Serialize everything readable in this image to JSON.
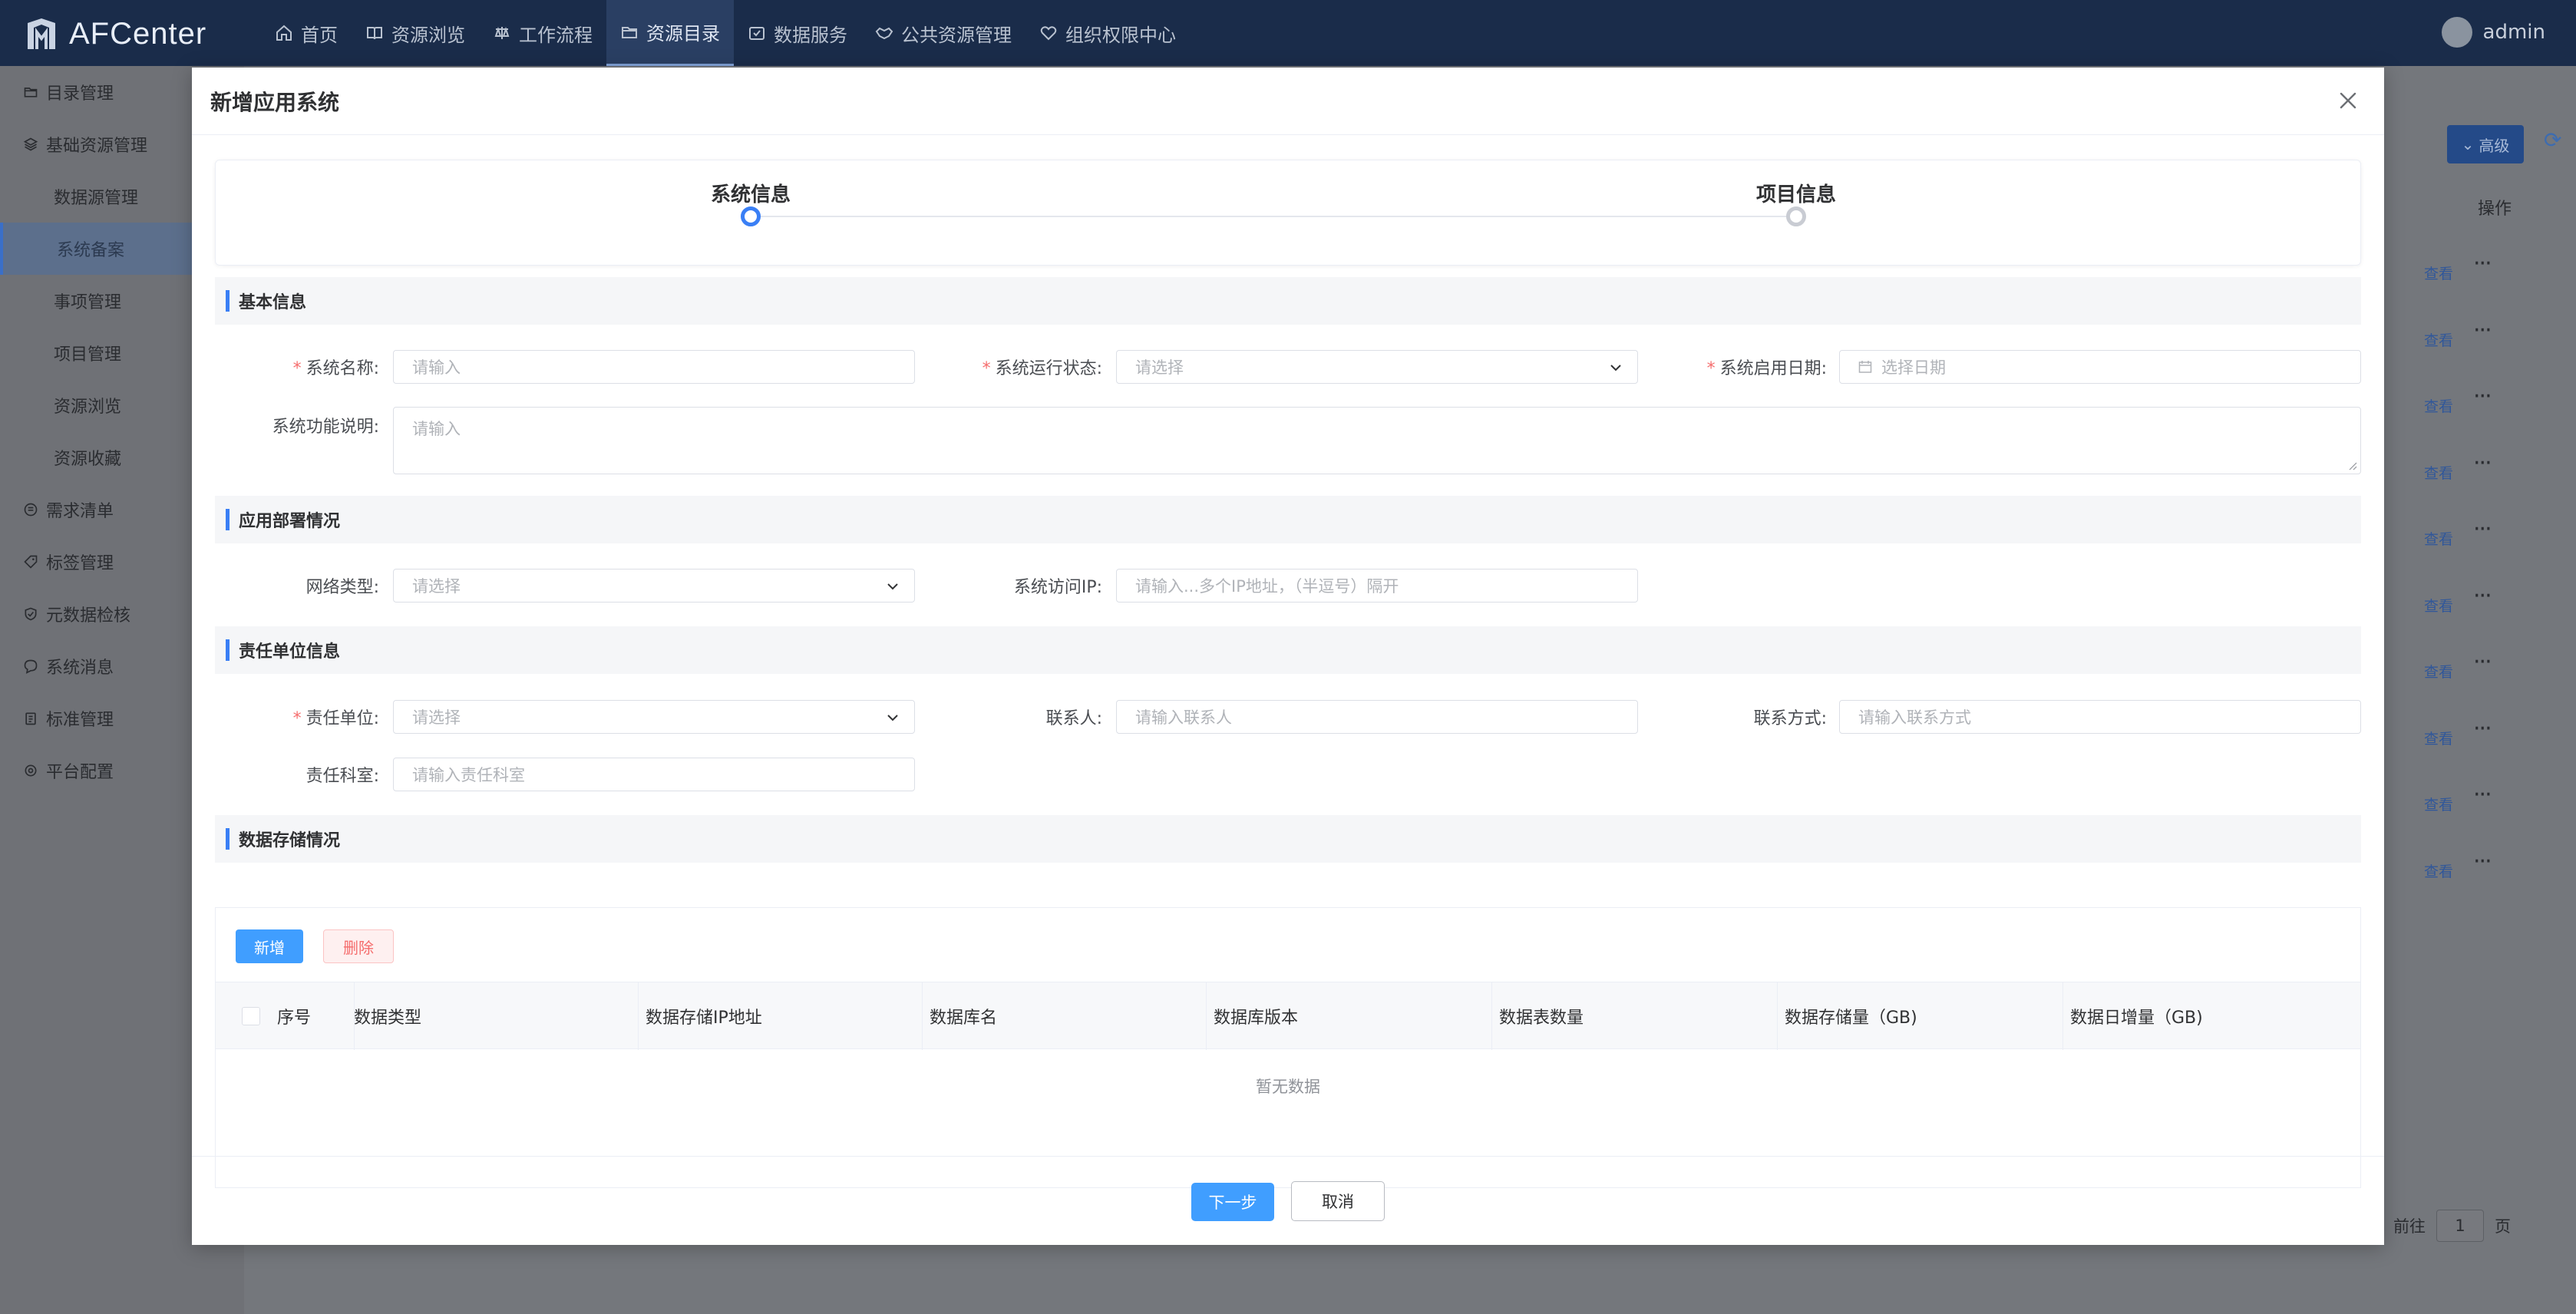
{
  "app": {
    "logo_text": "AFCenter",
    "user": "admin"
  },
  "nav": [
    {
      "label": "首页",
      "icon": "home-icon"
    },
    {
      "label": "资源浏览",
      "icon": "book-icon"
    },
    {
      "label": "工作流程",
      "icon": "workflow-icon"
    },
    {
      "label": "资源目录",
      "icon": "folder-icon",
      "active": true
    },
    {
      "label": "数据服务",
      "icon": "data-service-icon"
    },
    {
      "label": "公共资源管理",
      "icon": "public-resource-icon"
    },
    {
      "label": "组织权限中心",
      "icon": "heart-shield-icon"
    }
  ],
  "sidebar": [
    {
      "label": "目录管理",
      "icon": "folder-icon"
    },
    {
      "label": "基础资源管理",
      "icon": "layers-icon"
    },
    {
      "label": "数据源管理",
      "sub": true
    },
    {
      "label": "系统备案",
      "sub": true,
      "active": true
    },
    {
      "label": "事项管理",
      "sub": true
    },
    {
      "label": "项目管理",
      "sub": true
    },
    {
      "label": "资源浏览",
      "sub": true
    },
    {
      "label": "资源收藏",
      "sub": true
    },
    {
      "label": "需求清单",
      "icon": "list-icon"
    },
    {
      "label": "标签管理",
      "icon": "tag-icon"
    },
    {
      "label": "元数据检核",
      "icon": "check-shield-icon"
    },
    {
      "label": "系统消息",
      "icon": "message-icon"
    },
    {
      "label": "标准管理",
      "icon": "clipboard-icon"
    },
    {
      "label": "平台配置",
      "icon": "settings-icon"
    }
  ],
  "background": {
    "advanced_label": "高级",
    "ops_header": "操作",
    "view_label": "查看",
    "row_count": 10,
    "pager_goto": "前往",
    "pager_page": "1",
    "pager_unit": "页"
  },
  "modal": {
    "title": "新增应用系统",
    "steps": [
      {
        "title": "系统信息",
        "active": true
      },
      {
        "title": "项目信息",
        "active": false
      }
    ],
    "sections": {
      "basic": "基本信息",
      "deploy": "应用部署情况",
      "owner": "责任单位信息",
      "storage": "数据存储情况"
    },
    "fields": {
      "system_name": {
        "label": "系统名称:",
        "placeholder": "请输入",
        "required": true
      },
      "run_status": {
        "label": "系统运行状态:",
        "placeholder": "请选择",
        "required": true
      },
      "start_date": {
        "label": "系统启用日期:",
        "placeholder": "选择日期",
        "required": true
      },
      "description": {
        "label": "系统功能说明:",
        "placeholder": "请输入"
      },
      "network_type": {
        "label": "网络类型:",
        "placeholder": "请选择"
      },
      "access_ip": {
        "label": "系统访问IP:",
        "placeholder": "请输入...多个IP地址，（半逗号）隔开"
      },
      "owner_unit": {
        "label": "责任单位:",
        "placeholder": "请选择",
        "required": true
      },
      "contact": {
        "label": "联系人:",
        "placeholder": "请输入联系人"
      },
      "contact_method": {
        "label": "联系方式:",
        "placeholder": "请输入联系方式"
      },
      "owner_dept": {
        "label": "责任科室:",
        "placeholder": "请输入责任科室"
      }
    },
    "storage": {
      "add_label": "新增",
      "delete_label": "删除",
      "columns": [
        "序号",
        "数据类型",
        "数据存储IP地址",
        "数据库名",
        "数据库版本",
        "数据表数量",
        "数据存储量（GB)",
        "数据日增量（GB)"
      ],
      "empty_text": "暂无数据"
    },
    "footer": {
      "next_label": "下一步",
      "cancel_label": "取消"
    }
  }
}
